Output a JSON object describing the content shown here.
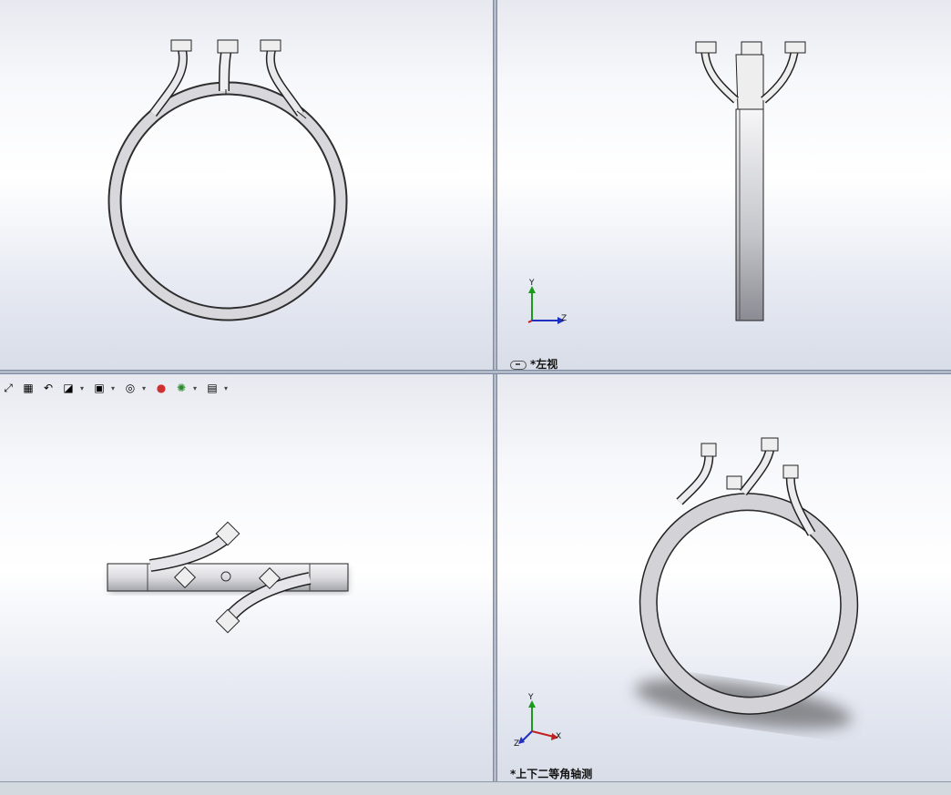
{
  "viewports": {
    "left": {
      "label": "*左视"
    },
    "iso": {
      "label": "*上下二等角轴测"
    }
  },
  "axes": {
    "x": "X",
    "y": "Y",
    "z": "Z"
  },
  "toolbar": {
    "icons": [
      "zoom-to-fit-icon",
      "zoom-area-icon",
      "previous-view-icon",
      "section-view-icon",
      "view-orientation-icon",
      "display-style-icon",
      "hide-show-items-icon",
      "edit-appearance-icon",
      "apply-scene-icon",
      "view-settings-icon"
    ]
  }
}
